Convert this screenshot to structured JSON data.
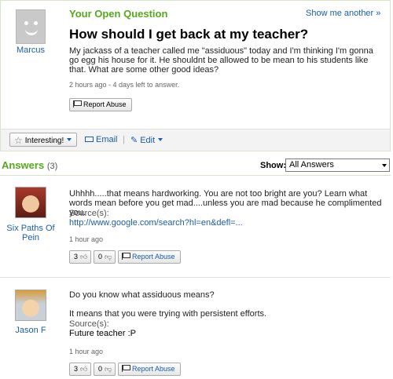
{
  "question": {
    "section_label": "Your Open Question",
    "show_another": "Show me another »",
    "asker": "Marcus",
    "title": "How should I get back at my teacher?",
    "body": "My jackass of a teacher called me \"assiduous\" today and I'm thinking I'm gonna go egg his house for it. He shouldnt be allowed to be mean to his students like that. What are some other good ideas?",
    "time": "2 hours ago - 4 days left to answer.",
    "report_label": "Report Abuse",
    "interesting_label": "Interesting!",
    "email_label": "Email",
    "edit_label": "Edit"
  },
  "answers_header": {
    "label": "Answers",
    "count": "(3)",
    "show_label": "Show:",
    "show_value": "All Answers"
  },
  "answers": [
    {
      "name_line1": "Six Paths Of",
      "name_line2": "Pein",
      "text": "Uhhhh.....that means hardworking. You are not too bright are you? Learn what words mean before you get mad....unless you are mad because he complimented you.",
      "source_label": "Source(s):",
      "source": "http://www.google.com/search?hl=en&defl=...",
      "time": "1 hour ago",
      "up": "3",
      "down": "0",
      "report_label": "Report Abuse"
    },
    {
      "name": "Jason F",
      "text1": "Do you know what assiduous means?",
      "text2": "It means that you were trying with persistent efforts.",
      "source_label": "Source(s):",
      "source": "Future teacher :P",
      "time": "1 hour ago",
      "up": "3",
      "down": "0",
      "report_label": "Report Abuse"
    }
  ]
}
